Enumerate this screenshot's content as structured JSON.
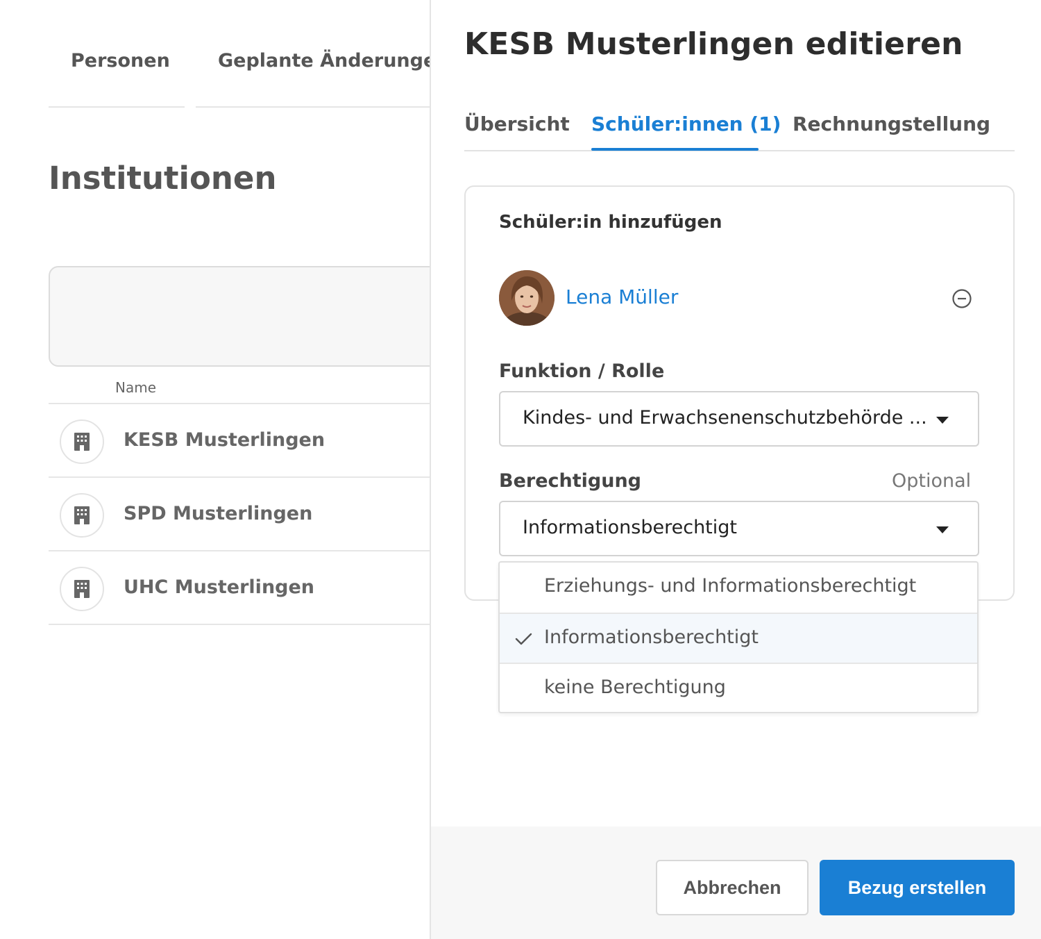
{
  "background": {
    "tabs": [
      "Personen",
      "Geplante Änderungen"
    ],
    "title": "Institutionen",
    "column_header": "Name",
    "rows": [
      {
        "name": "KESB Musterlingen",
        "icon": "building-icon"
      },
      {
        "name": "SPD Musterlingen",
        "icon": "building-icon"
      },
      {
        "name": "UHC Musterlingen",
        "icon": "building-icon"
      }
    ]
  },
  "panel": {
    "title": "KESB Musterlingen editieren",
    "tabs": [
      {
        "label": "Übersicht",
        "active": false
      },
      {
        "label": "Schüler:innen (1)",
        "active": true
      },
      {
        "label": "Rechnungstellung",
        "active": false
      }
    ],
    "card": {
      "heading": "Schüler:in hinzufügen",
      "person": {
        "name": "Lena Müller",
        "avatar": "person-photo",
        "remove_icon": "minus-circle-icon"
      },
      "role": {
        "label": "Funktion / Rolle",
        "value": "Kindes- und Erwachsenenschutzbehörde ..."
      },
      "permission": {
        "label": "Berechtigung",
        "optional": "Optional",
        "value": "Informationsberechtigt",
        "options": [
          {
            "label": "Erziehungs- und Informationsberechtigt",
            "selected": false
          },
          {
            "label": "Informationsberechtigt",
            "selected": true
          },
          {
            "label": "keine Berechtigung",
            "selected": false
          }
        ]
      }
    },
    "footer": {
      "cancel_label": "Abbrechen",
      "submit_label": "Bezug erstellen"
    }
  },
  "colors": {
    "accent": "#1a7fd4",
    "text": "#333333",
    "border": "#e2e2e2"
  }
}
